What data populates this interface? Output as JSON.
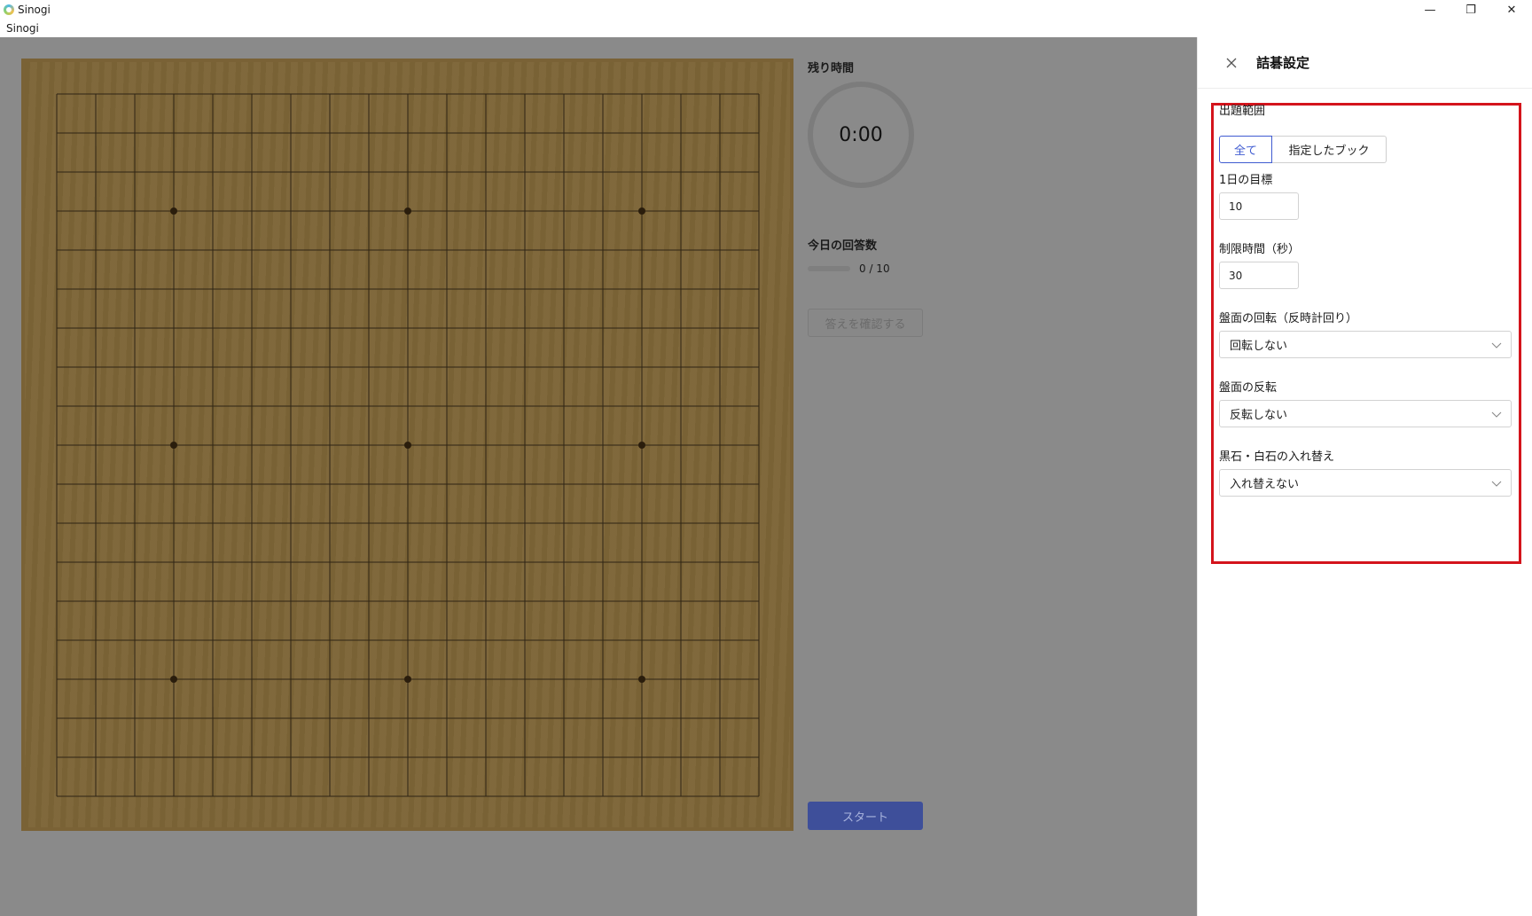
{
  "window": {
    "title": "Sinogi",
    "menu": "Sinogi",
    "minimize": "—",
    "maximize": "❐",
    "close": "✕"
  },
  "board": {
    "size": 19,
    "star_points": [
      [
        3,
        3
      ],
      [
        3,
        9
      ],
      [
        3,
        15
      ],
      [
        9,
        3
      ],
      [
        9,
        9
      ],
      [
        9,
        15
      ],
      [
        15,
        3
      ],
      [
        15,
        9
      ],
      [
        15,
        15
      ]
    ]
  },
  "side": {
    "remaining_time_label": "残り時間",
    "timer_value": "0:00",
    "today_answers_label": "今日の回答数",
    "progress_text": "0 / 10",
    "progress_fraction": 0,
    "confirm_button": "答えを確認する",
    "start_button": "スタート"
  },
  "drawer": {
    "title": "詰碁設定",
    "scope": {
      "label": "出題範囲",
      "options": [
        "全て",
        "指定したブック"
      ],
      "selected": "全て"
    },
    "daily_goal": {
      "label": "1日の目標",
      "value": "10"
    },
    "time_limit": {
      "label": "制限時間（秒）",
      "value": "30"
    },
    "rotation": {
      "label": "盤面の回転（反時計回り）",
      "value": "回転しない"
    },
    "flip": {
      "label": "盤面の反転",
      "value": "反転しない"
    },
    "swap": {
      "label": "黒石・白石の入れ替え",
      "value": "入れ替えない"
    }
  },
  "colors": {
    "accent": "#3f5bd1",
    "highlight": "#d4141c",
    "overlay": "#8a8a8a"
  }
}
